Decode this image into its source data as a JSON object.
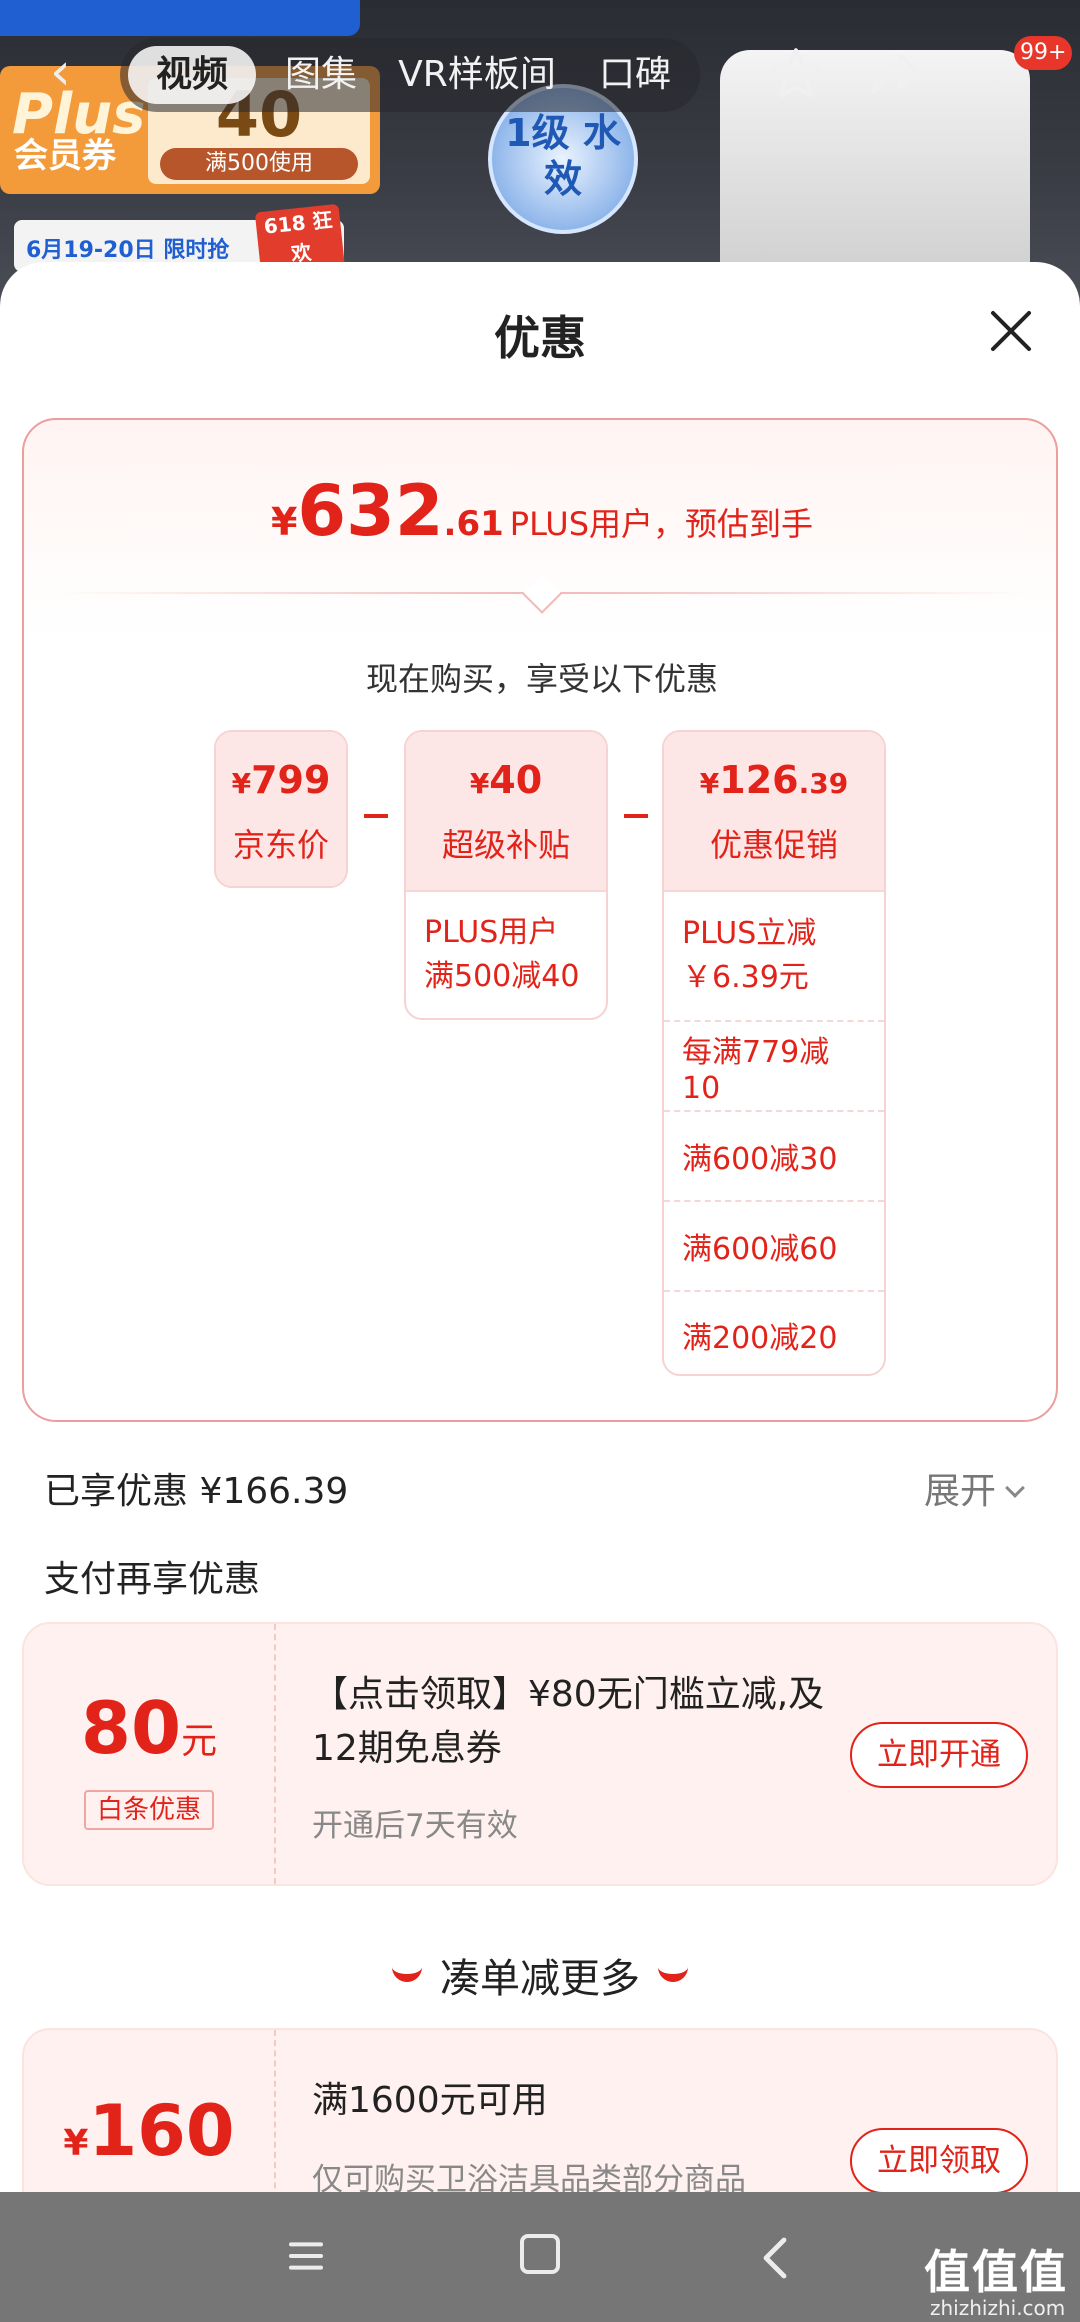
{
  "hero": {
    "plus_word": "Plus",
    "plus_member": "会员券",
    "plus_amount": "40",
    "plus_condition": "满500使用",
    "promo_strip": "6月19-20日 限时抢",
    "promo_618": "618 狂欢",
    "water_badge": "1级 水效"
  },
  "topnav": {
    "tabs": [
      {
        "label": "视频",
        "active": true
      },
      {
        "label": "图集"
      },
      {
        "label": "VR样板间"
      },
      {
        "label": "口碑"
      }
    ],
    "badge": "99+"
  },
  "sheet": {
    "title": "优惠",
    "summary": {
      "yen": "¥",
      "price_int": "632",
      "price_dec": ".61",
      "note": "PLUS用户，预估到手",
      "buy_now": "现在购买，享受以下优惠",
      "columns": [
        {
          "amount_main": "799",
          "amount_small": "",
          "label": "京东价",
          "items": []
        },
        {
          "amount_main": "40",
          "amount_small": "",
          "label": "超级补贴",
          "items": [
            "PLUS用户\n满500减40"
          ]
        },
        {
          "amount_main": "126",
          "amount_small": ".39",
          "label": "优惠促销",
          "items": [
            "PLUS立减\n￥6.39元",
            "每满779减10",
            "满600减30",
            "满600减60",
            "满200减20"
          ]
        }
      ],
      "yen_sign": "¥"
    },
    "enjoyed": "已享优惠 ¥166.39",
    "expand": "展开",
    "pay_title": "支付再享优惠",
    "coupon1": {
      "amount": "80",
      "unit": "元",
      "tag": "白条优惠",
      "desc": "【点击领取】¥80无门槛立减,及12期免息券",
      "sub": "开通后7天有效",
      "button": "立即开通"
    },
    "more_title": "凑单减更多",
    "coupon2": {
      "yen": "¥",
      "amount": "160",
      "desc": "满1600元可用",
      "sub": "仅可购买卫浴洁具品类部分商品",
      "button": "立即领取"
    }
  },
  "navbar": {
    "watermark": "值值值",
    "watermark_sub": "zhizhizhi.com"
  },
  "colors": {
    "accent": "#e2231a",
    "card_border": "#ec9d9d",
    "head_bg": "#fde7e6",
    "coupon_bg": "#fff1ef"
  }
}
